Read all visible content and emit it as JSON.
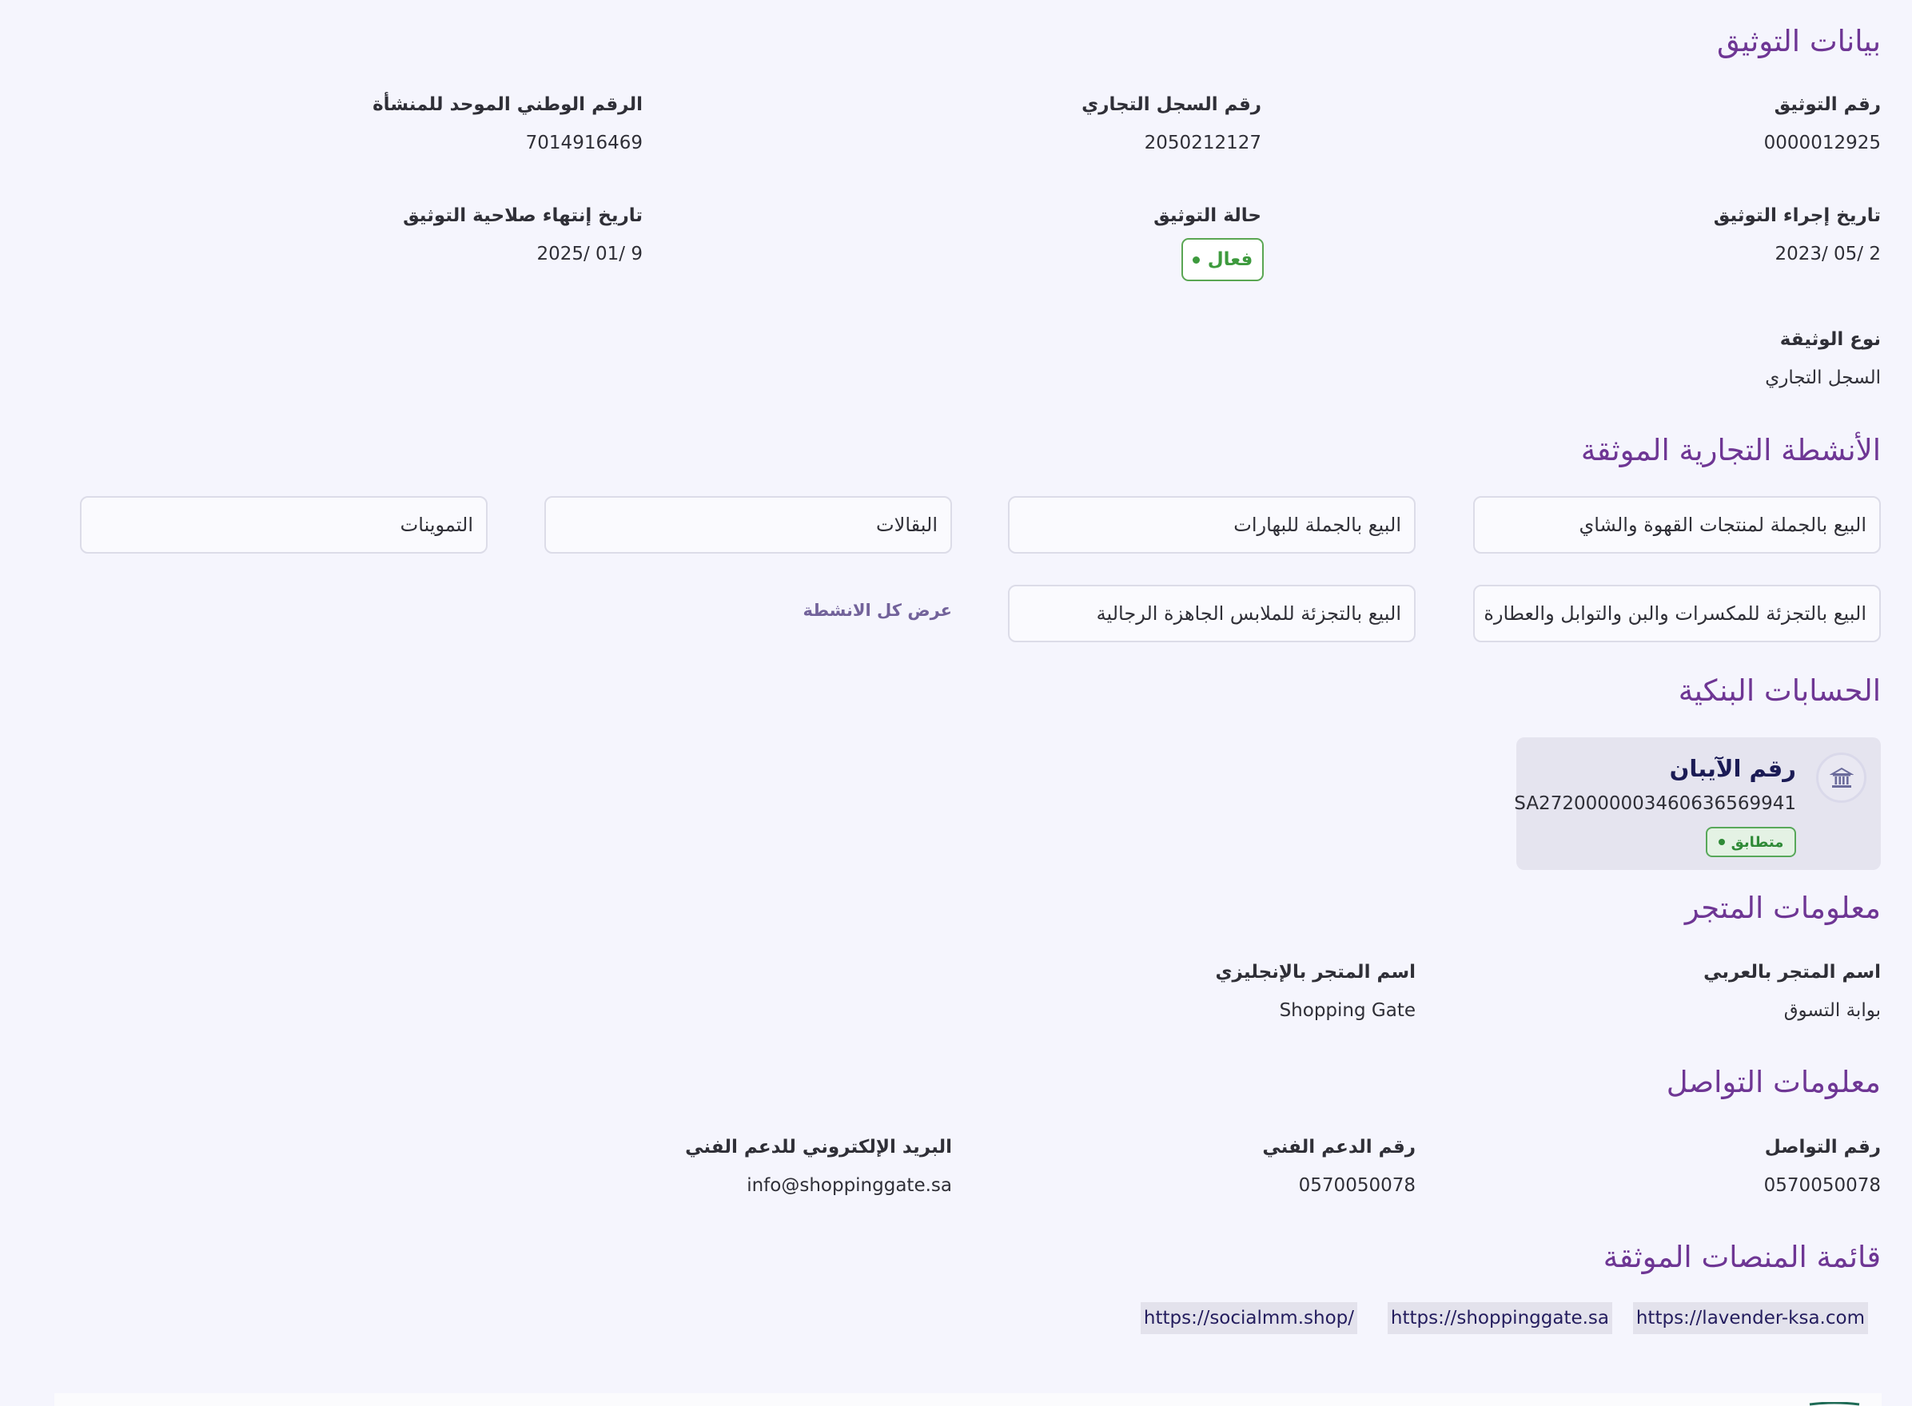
{
  "verification": {
    "title": "بيانات التوثيق",
    "verification_number": {
      "label": "رقم التوثيق",
      "value": "0000012925"
    },
    "cr_number": {
      "label": "رقم السجل التجاري",
      "value": "2050212127"
    },
    "national_number": {
      "label": "الرقم الوطني الموحد للمنشأة",
      "value": "7014916469"
    },
    "verification_date": {
      "label": "تاريخ إجراء التوثيق",
      "value": "2023/ 05/ 2"
    },
    "status": {
      "label": "حالة التوثيق",
      "value": "فعال",
      "color": "#3d9a3d"
    },
    "expiry_date": {
      "label": "تاريخ إنتهاء صلاحية التوثيق",
      "value": "2025/ 01/ 9"
    },
    "document_type": {
      "label": "نوع الوثيقة",
      "value": "السجل التجاري"
    }
  },
  "activities": {
    "title": "الأنشطة التجارية الموثقة",
    "items": [
      "البيع بالجملة لمنتجات القهوة والشاي",
      "البيع بالجملة للبهارات",
      "البقالات",
      "التموينات",
      "البيع بالتجزئة للمكسرات والبن والتوابل والعطارة",
      "البيع بالتجزئة للملابس الجاهزة الرجالية"
    ],
    "view_all_label": "عرض كل الانشطة"
  },
  "bank": {
    "title": "الحسابات البنكية",
    "card_title": "رقم الآيبان",
    "iban": "SA2720000003460636569941",
    "badge": "متطابق",
    "icon": "bank-icon"
  },
  "store": {
    "title": "معلومات المتجر",
    "name_ar": {
      "label": "اسم المتجر بالعربي",
      "value": "بوابة التسوق"
    },
    "name_en": {
      "label": "اسم المتجر بالإنجليزي",
      "value": "Shopping Gate"
    }
  },
  "contact": {
    "title": "معلومات التواصل",
    "phone": {
      "label": "رقم التواصل",
      "value": "0570050078"
    },
    "support_phone": {
      "label": "رقم الدعم الفني",
      "value": "0570050078"
    },
    "support_email": {
      "label": "البريد الإلكتروني للدعم الفني",
      "value": "info@shoppinggate.sa"
    }
  },
  "platforms": {
    "title": "قائمة المنصات الموثقة",
    "links": [
      "https://lavender-ksa.com",
      "https://shoppinggate.sa",
      "https://socialmm.shop/"
    ]
  },
  "colors": {
    "background": "#f5f5fd",
    "section_title": "#6e3694",
    "active_green": "#3d9a3d",
    "link_text": "#241d5e",
    "bank_card_bg": "#e5e4ef"
  }
}
